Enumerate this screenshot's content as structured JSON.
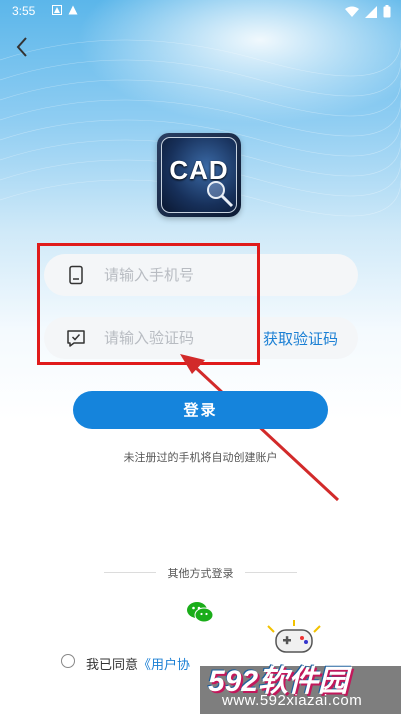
{
  "status_bar": {
    "time": "3:55"
  },
  "logo": {
    "text": "CAD"
  },
  "form": {
    "phone_placeholder": "请输入手机号",
    "code_placeholder": "请输入验证码",
    "get_code_label": "获取验证码"
  },
  "login": {
    "button_label": "登录",
    "hint": "未注册过的手机将自动创建账户"
  },
  "other_login": {
    "label": "其他方式登录"
  },
  "agreement": {
    "prefix": "我已同意",
    "link": "《用户协"
  },
  "watermark": {
    "title": "592软件园",
    "url": "www.592xiazai.com"
  },
  "colors": {
    "accent": "#1584dc",
    "highlight": "#e01b1b",
    "wechat": "#1aad19"
  }
}
